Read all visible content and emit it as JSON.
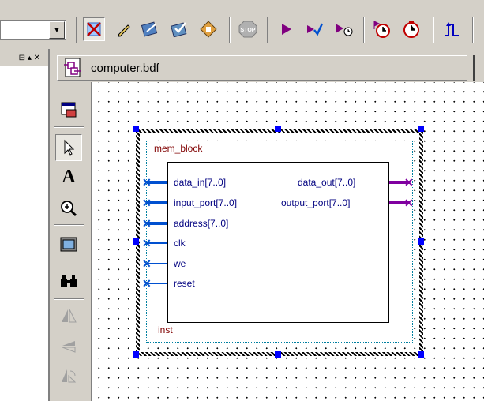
{
  "toolbar": {
    "combo_value": "",
    "buttons": [
      {
        "icon": "select-x-icon"
      },
      {
        "icon": "pencil-icon"
      },
      {
        "icon": "compile-icon"
      },
      {
        "icon": "check-icon"
      },
      {
        "icon": "chip-icon"
      },
      {
        "icon": "stop-icon",
        "label": "STOP"
      },
      {
        "icon": "play-icon"
      },
      {
        "icon": "check-flow-icon"
      },
      {
        "icon": "run-timing-icon"
      },
      {
        "icon": "timer-flag-icon"
      },
      {
        "icon": "timer-icon"
      },
      {
        "icon": "waveform-icon"
      }
    ]
  },
  "document": {
    "tab_title": "computer.bdf"
  },
  "symbol": {
    "name": "mem_block",
    "instance": "inst",
    "inputs": [
      {
        "label": "data_in[7..0]",
        "bus": true
      },
      {
        "label": "input_port[7..0]",
        "bus": true
      },
      {
        "label": "address[7..0]",
        "bus": true
      },
      {
        "label": "clk",
        "bus": false
      },
      {
        "label": "we",
        "bus": false
      },
      {
        "label": "reset",
        "bus": false
      }
    ],
    "outputs": [
      {
        "label": "data_out[7..0]",
        "bus": true
      },
      {
        "label": "output_port[7..0]",
        "bus": true
      }
    ]
  },
  "left_panel": {
    "controls": "⊟ ▴ ✕"
  },
  "colors": {
    "bus_in": "#0050d0",
    "bus_out": "#8000a0",
    "handle": "#0000ff",
    "symbol_text": "#800000",
    "pin_text": "#000080"
  }
}
